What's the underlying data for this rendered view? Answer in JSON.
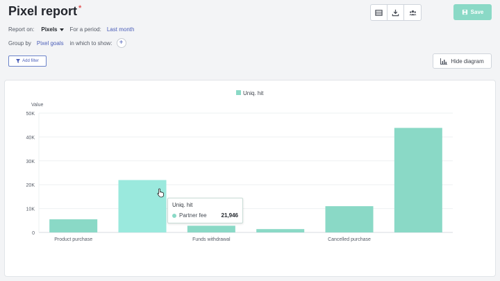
{
  "header": {
    "title": "Pixel report",
    "required_mark": "*"
  },
  "toolbar": {
    "buttons": [
      {
        "icon": "table-icon"
      },
      {
        "icon": "download-icon"
      },
      {
        "icon": "users-icon"
      }
    ],
    "save_label": "Save"
  },
  "filters": {
    "report_on_label": "Report on:",
    "report_on_value": "Pixels",
    "period_label": "For a period:",
    "period_value": "Last month",
    "group_by_label": "Group by",
    "group_by_value": "Pixel goals",
    "show_label": "in which to show:",
    "add_symbol": "+",
    "add_filter_label": "Add filter",
    "hide_diagram_label": "Hide diagram"
  },
  "colors": {
    "accent": "#8ad9c6",
    "bar": "#8ad9c6",
    "bar_hover": "#9ae9dd",
    "link": "#4a5db8"
  },
  "chart_data": {
    "type": "bar",
    "ylabel": "Value",
    "legend": "Uniq. hit",
    "legend_position": "top-center",
    "ylim": [
      0,
      50000
    ],
    "y_ticks": [
      "0",
      "10K",
      "20K",
      "30K",
      "40K",
      "50K"
    ],
    "categories": [
      "Product purchase",
      "Partner fee",
      "Funds withdrawal",
      "",
      "Cancelled purchase",
      ""
    ],
    "x_tick_labels": [
      "Product purchase",
      "",
      "Funds withdrawal",
      "",
      "Cancelled purchase",
      ""
    ],
    "values": [
      5500,
      21946,
      2800,
      1400,
      11000,
      43800
    ],
    "grid": true,
    "highlighted_index": 1
  },
  "tooltip": {
    "title": "Uniq. hit",
    "label": "Partner fee",
    "value": "21,946"
  }
}
